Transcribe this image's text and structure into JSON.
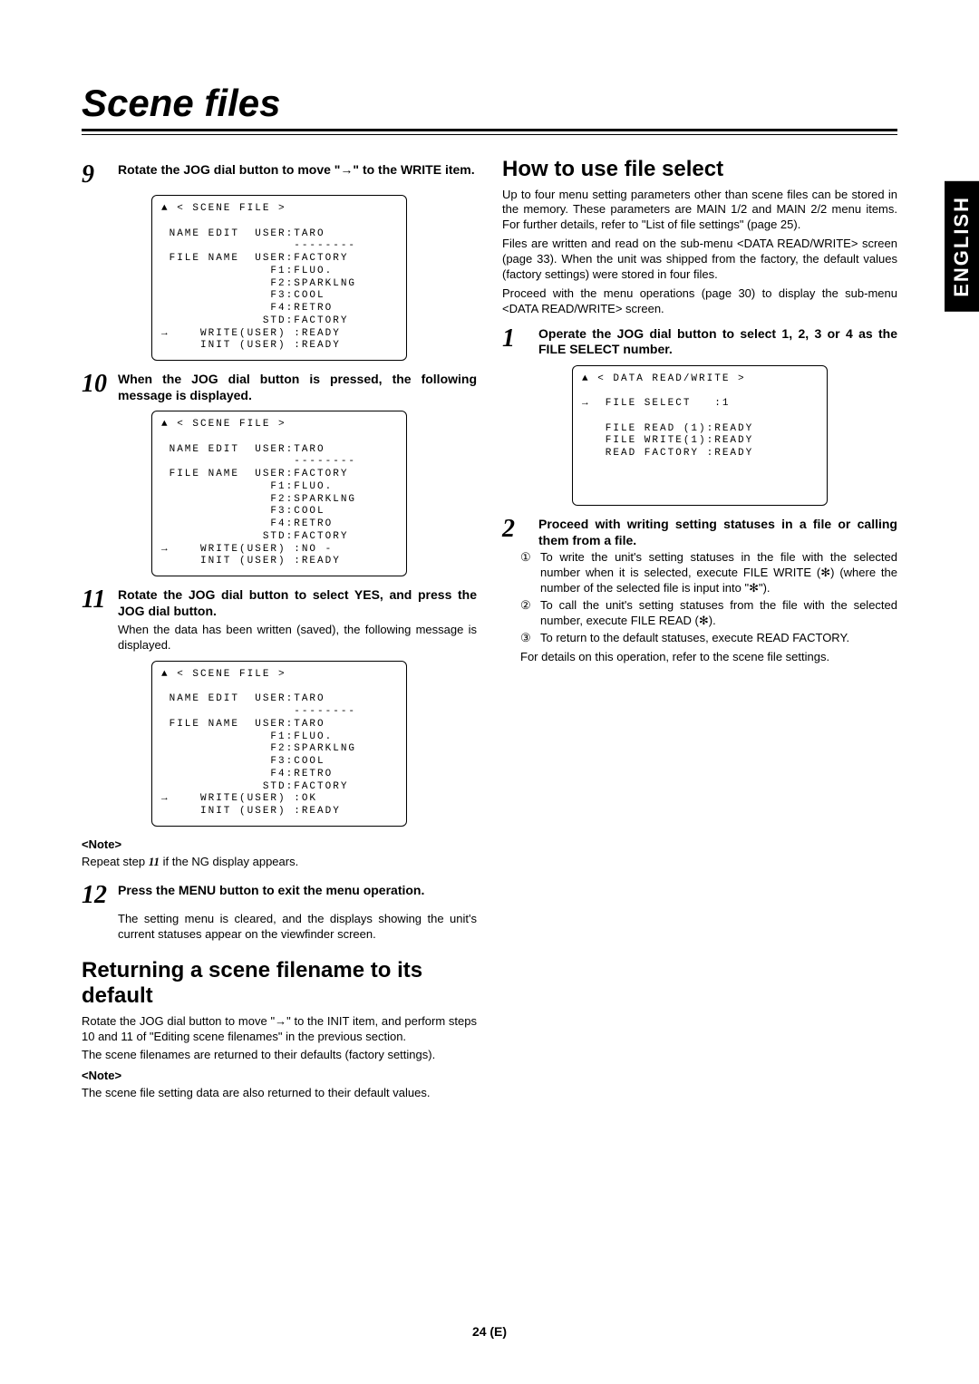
{
  "side_tab": "ENGLISH",
  "title": "Scene files",
  "page_num": "24 (E)",
  "left": {
    "step9": "Rotate the JOG dial button to move \"→\" to the WRITE item.",
    "screen1": "▲ < SCENE FILE >\n\n NAME EDIT  USER:TARO\n                 --------\n FILE NAME  USER:FACTORY\n              F1:FLUO.\n              F2:SPARKLNG\n              F3:COOL\n              F4:RETRO\n             STD:FACTORY\n→    WRITE(USER) :READY\n     INIT (USER) :READY",
    "step10": "When the JOG dial button is pressed, the following message is displayed.",
    "screen2": "▲ < SCENE FILE >\n\n NAME EDIT  USER:TARO\n                 --------\n FILE NAME  USER:FACTORY\n              F1:FLUO.\n              F2:SPARKLNG\n              F3:COOL\n              F4:RETRO\n             STD:FACTORY\n→    WRITE(USER) :NO -\n     INIT (USER) :READY",
    "step11_head": "Rotate the JOG dial button to select YES, and press the JOG dial button.",
    "step11_body": "When the data has been written (saved), the following message is displayed.",
    "screen3": "▲ < SCENE FILE >\n\n NAME EDIT  USER:TARO\n                 --------\n FILE NAME  USER:TARO\n              F1:FLUO.\n              F2:SPARKLNG\n              F3:COOL\n              F4:RETRO\n             STD:FACTORY\n→    WRITE(USER) :OK\n     INIT (USER) :READY",
    "note1_label": "<Note>",
    "note1_body": "Repeat step 11 if the NG display appears.",
    "step12_head": "Press the MENU button to exit the menu operation.",
    "step12_body": "The setting menu is cleared, and the displays showing the unit's current statuses appear on the viewfinder screen.",
    "h2": "Returning a scene filename to its default",
    "ret_p1": "Rotate the JOG dial button to move \"→\" to the INIT item, and perform steps 10 and 11 of \"Editing scene filenames\" in the previous section.",
    "ret_p2": "The scene filenames are returned to their defaults (factory settings).",
    "note2_label": "<Note>",
    "note2_body": "The scene file setting data are also returned to their default values."
  },
  "right": {
    "h2": "How to use file select",
    "intro1": "Up to four menu setting parameters other than scene files can be stored in the memory.  These parameters are MAIN 1/2 and MAIN 2/2 menu items.  For further details, refer to \"List of file settings\" (page 25).",
    "intro2": "Files are written and read on the sub-menu <DATA READ/WRITE> screen (page 33). When the unit was shipped from the factory, the default values (factory settings) were stored in four files.",
    "intro3": "Proceed with the menu operations (page 30) to display the sub-menu <DATA READ/WRITE> screen.",
    "step1": "Operate the JOG dial button to select 1, 2, 3 or 4 as the FILE SELECT number.",
    "screen4": "▲ < DATA READ/WRITE >\n\n→  FILE SELECT   :1\n\n   FILE READ (1):READY\n   FILE WRITE(1):READY\n   READ FACTORY :READY\n\n\n\n",
    "step2": "Proceed with writing setting statuses in a file or calling them from a file.",
    "b1": "To write the unit's setting statuses in the file with the selected number when it is selected, execute FILE WRITE (✻) (where the number of the selected file is input into \"✻\").",
    "b2": "To call the unit's setting statuses from the file with the selected number, execute FILE READ (✻).",
    "b3": "To return to the default statuses, execute READ FACTORY.",
    "tail": "For details on this operation, refer to the scene file settings."
  }
}
